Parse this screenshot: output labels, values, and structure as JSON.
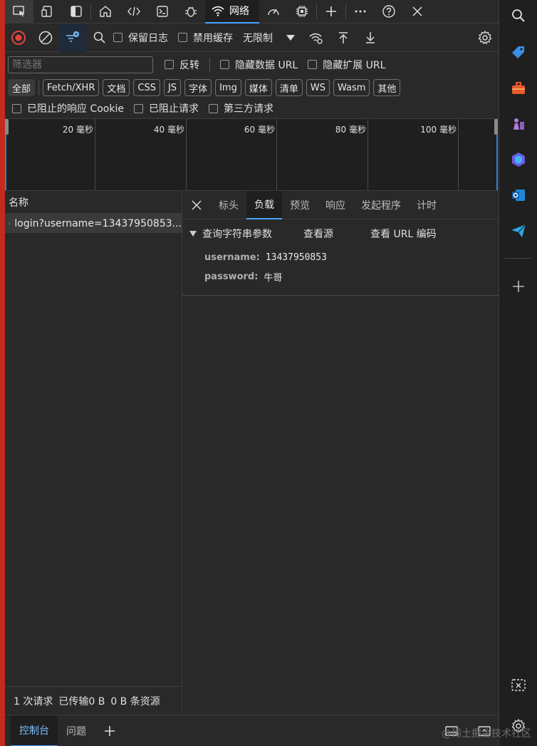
{
  "tabbar": {
    "network_label": "网络"
  },
  "toolbar": {
    "preserve_log": "保留日志",
    "disable_cache": "禁用缓存",
    "throttling": "无限制"
  },
  "filter": {
    "placeholder": "筛选器",
    "invert": "反转",
    "hide_data_urls": "隐藏数据 URL",
    "hide_ext_urls": "隐藏扩展 URL"
  },
  "types": [
    "全部",
    "Fetch/XHR",
    "文档",
    "CSS",
    "JS",
    "字体",
    "Img",
    "媒体",
    "清单",
    "WS",
    "Wasm",
    "其他"
  ],
  "row3": {
    "blocked_cookies": "已阻止的响应 Cookie",
    "blocked_requests": "已阻止请求",
    "third_party": "第三方请求"
  },
  "timeline": {
    "ticks": [
      "20 毫秒",
      "40 毫秒",
      "60 毫秒",
      "80 毫秒",
      "100 毫秒"
    ]
  },
  "list": {
    "header": "名称",
    "rows": [
      "login?username=13437950853..."
    ]
  },
  "status": {
    "requests": "1 次请求",
    "transferred": "已传输0 B",
    "resources": "0 B 条资源"
  },
  "detail": {
    "tabs": [
      "标头",
      "负载",
      "预览",
      "响应",
      "发起程序",
      "计时"
    ],
    "active_tab": "负载",
    "section_title": "查询字符串参数",
    "view_source": "查看源",
    "view_url_encoded": "查看 URL 编码",
    "params": [
      {
        "key": "username:",
        "value": "13437950853"
      },
      {
        "key": "password:",
        "value": "牛哥"
      }
    ]
  },
  "drawer": {
    "console": "控制台",
    "issues": "问题"
  },
  "watermark": "@稀土掘金技术社区",
  "colors": {
    "accent": "#4aa3ff",
    "record": "#e0443e",
    "edge_red": "#c42b1c"
  }
}
